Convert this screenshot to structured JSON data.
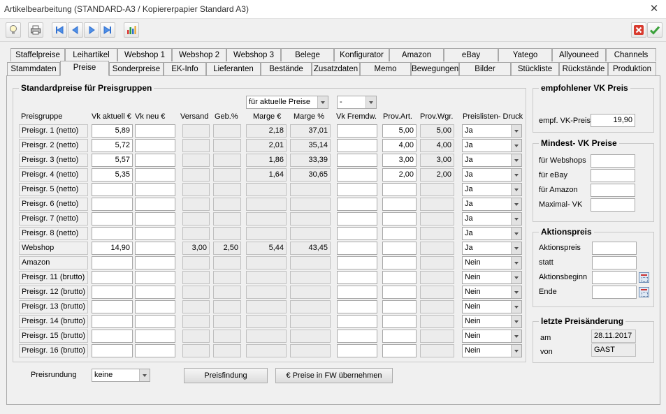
{
  "window": {
    "title": "Artikelbearbeitung (STANDARD-A3 / Kopiererpapier Standard A3)"
  },
  "tabs_row1": [
    "Staffelpreise",
    "Leihartikel",
    "Webshop 1",
    "Webshop 2",
    "Webshop 3",
    "Belege",
    "Konfigurator",
    "Amazon",
    "eBay",
    "Yatego",
    "Allyouneed",
    "Channels"
  ],
  "tabs_row2": [
    "Stammdaten",
    "Preise",
    "Sonderpreise",
    "EK-Info",
    "Lieferanten",
    "Bestände",
    "Zusatzdaten",
    "Memo",
    "Bewegungen",
    "Bilder",
    "Stückliste",
    "Rückstände",
    "Produktion"
  ],
  "standard": {
    "title": "Standardpreise für Preisgruppen",
    "filter1": "für aktuelle Preise",
    "filter2": "-",
    "headers": [
      "Preisgruppe",
      "Vk aktuell €",
      "Vk neu €",
      "Versand",
      "Geb.%",
      "Marge €",
      "Marge %",
      "Vk Fremdw.",
      "Prov.Art.",
      "Prov.Wgr.",
      "Preislisten- Druck"
    ],
    "rows": [
      {
        "name": "Preisgr. 1 (netto)",
        "vk": "5,89",
        "vkneu": "",
        "versand": "",
        "geb": "",
        "marge": "2,18",
        "margep": "37,01",
        "fw": "",
        "provart": "5,00",
        "provwgr": "5,00",
        "druck": "Ja"
      },
      {
        "name": "Preisgr. 2 (netto)",
        "vk": "5,72",
        "vkneu": "",
        "versand": "",
        "geb": "",
        "marge": "2,01",
        "margep": "35,14",
        "fw": "",
        "provart": "4,00",
        "provwgr": "4,00",
        "druck": "Ja"
      },
      {
        "name": "Preisgr. 3 (netto)",
        "vk": "5,57",
        "vkneu": "",
        "versand": "",
        "geb": "",
        "marge": "1,86",
        "margep": "33,39",
        "fw": "",
        "provart": "3,00",
        "provwgr": "3,00",
        "druck": "Ja"
      },
      {
        "name": "Preisgr. 4 (netto)",
        "vk": "5,35",
        "vkneu": "",
        "versand": "",
        "geb": "",
        "marge": "1,64",
        "margep": "30,65",
        "fw": "",
        "provart": "2,00",
        "provwgr": "2,00",
        "druck": "Ja"
      },
      {
        "name": "Preisgr. 5 (netto)",
        "vk": "",
        "vkneu": "",
        "versand": "",
        "geb": "",
        "marge": "",
        "margep": "",
        "fw": "",
        "provart": "",
        "provwgr": "",
        "druck": "Ja"
      },
      {
        "name": "Preisgr. 6 (netto)",
        "vk": "",
        "vkneu": "",
        "versand": "",
        "geb": "",
        "marge": "",
        "margep": "",
        "fw": "",
        "provart": "",
        "provwgr": "",
        "druck": "Ja"
      },
      {
        "name": "Preisgr. 7 (netto)",
        "vk": "",
        "vkneu": "",
        "versand": "",
        "geb": "",
        "marge": "",
        "margep": "",
        "fw": "",
        "provart": "",
        "provwgr": "",
        "druck": "Ja"
      },
      {
        "name": "Preisgr. 8 (netto)",
        "vk": "",
        "vkneu": "",
        "versand": "",
        "geb": "",
        "marge": "",
        "margep": "",
        "fw": "",
        "provart": "",
        "provwgr": "",
        "druck": "Ja"
      },
      {
        "name": "Webshop",
        "vk": "14,90",
        "vkneu": "",
        "versand": "3,00",
        "geb": "2,50",
        "marge": "5,44",
        "margep": "43,45",
        "fw": "",
        "provart": "",
        "provwgr": "",
        "druck": "Ja"
      },
      {
        "name": "Amazon",
        "vk": "",
        "vkneu": "",
        "versand": "",
        "geb": "",
        "marge": "",
        "margep": "",
        "fw": "",
        "provart": "",
        "provwgr": "",
        "druck": "Nein"
      },
      {
        "name": "Preisgr. 11 (brutto)",
        "vk": "",
        "vkneu": "",
        "versand": "",
        "geb": "",
        "marge": "",
        "margep": "",
        "fw": "",
        "provart": "",
        "provwgr": "",
        "druck": "Nein"
      },
      {
        "name": "Preisgr. 12 (brutto)",
        "vk": "",
        "vkneu": "",
        "versand": "",
        "geb": "",
        "marge": "",
        "margep": "",
        "fw": "",
        "provart": "",
        "provwgr": "",
        "druck": "Nein"
      },
      {
        "name": "Preisgr. 13 (brutto)",
        "vk": "",
        "vkneu": "",
        "versand": "",
        "geb": "",
        "marge": "",
        "margep": "",
        "fw": "",
        "provart": "",
        "provwgr": "",
        "druck": "Nein"
      },
      {
        "name": "Preisgr. 14 (brutto)",
        "vk": "",
        "vkneu": "",
        "versand": "",
        "geb": "",
        "marge": "",
        "margep": "",
        "fw": "",
        "provart": "",
        "provwgr": "",
        "druck": "Nein"
      },
      {
        "name": "Preisgr. 15 (brutto)",
        "vk": "",
        "vkneu": "",
        "versand": "",
        "geb": "",
        "marge": "",
        "margep": "",
        "fw": "",
        "provart": "",
        "provwgr": "",
        "druck": "Nein"
      },
      {
        "name": "Preisgr. 16 (brutto)",
        "vk": "",
        "vkneu": "",
        "versand": "",
        "geb": "",
        "marge": "",
        "margep": "",
        "fw": "",
        "provart": "",
        "provwgr": "",
        "druck": "Nein"
      }
    ]
  },
  "bottom": {
    "rounding_label": "Preisrundung",
    "rounding_value": "keine",
    "btn_preisfindung": "Preisfindung",
    "btn_fw": "€ Preise in FW übernehmen"
  },
  "empfohlen": {
    "title": "empfohlener VK Preis",
    "label": "empf. VK-Preis",
    "value": "19,90"
  },
  "mindest": {
    "title": "Mindest- VK Preise",
    "labels": [
      "für Webshops",
      "für eBay",
      "für Amazon",
      "Maximal- VK"
    ],
    "values": [
      "",
      "",
      "",
      ""
    ]
  },
  "aktion": {
    "title": "Aktionspreis",
    "labels": [
      "Aktionspreis",
      "statt",
      "Aktionsbeginn",
      "Ende"
    ],
    "values": [
      "",
      "",
      "",
      ""
    ]
  },
  "letzte": {
    "title": "letzte Preisänderung",
    "am_label": "am",
    "am_value": "28.11.2017",
    "von_label": "von",
    "von_value": "GAST"
  },
  "icons": [
    "lightbulb-icon",
    "printer-icon",
    "first-record-icon",
    "previous-record-icon",
    "next-record-icon",
    "last-record-icon",
    "chart-icon",
    "cancel-icon",
    "confirm-icon"
  ]
}
